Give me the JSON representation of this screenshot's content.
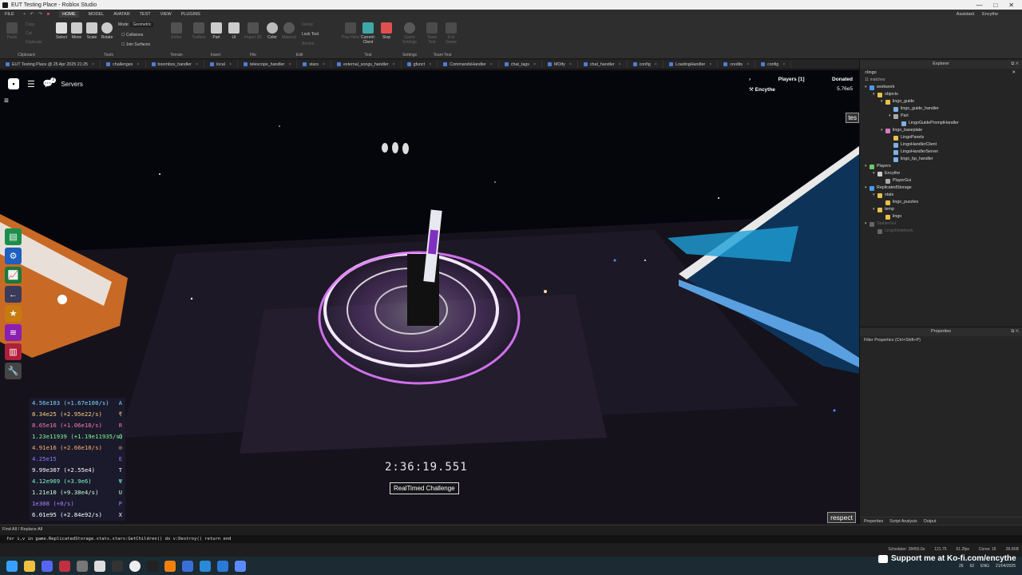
{
  "window": {
    "title": "EUT Testing Place - Roblox Studio",
    "controls": [
      "—",
      "□",
      "✕"
    ]
  },
  "menubar": {
    "file": "FILE",
    "tabs": [
      "HOME",
      "MODEL",
      "AVATAR",
      "TEST",
      "VIEW",
      "PLUGINS"
    ],
    "assistant": "Assistant",
    "user": "Encythe"
  },
  "ribbon": {
    "clipboard": {
      "label": "Clipboard",
      "paste": "Paste",
      "copy": "Copy",
      "cut": "Cut",
      "duplicate": "Duplicate"
    },
    "tools": {
      "label": "Tools",
      "select": "Select",
      "move": "Move",
      "scale": "Scale",
      "rotate": "Rotate",
      "mode_label": "Mode:",
      "mode_value": "Geometric",
      "collisions": "Collisions",
      "join_surfaces": "Join Surfaces"
    },
    "terrain": {
      "label": "Terrain",
      "editor": "Editor"
    },
    "insert": {
      "label": "Insert",
      "toolbox": "Toolbox",
      "part": "Part",
      "ui": "UI"
    },
    "file": {
      "label": "File",
      "import3d": "Import 3D"
    },
    "edit": {
      "label": "Edit",
      "color": "Color",
      "material": "Material",
      "group": "Group",
      "lock": "Lock Tool",
      "anchor": "Anchor"
    },
    "test": {
      "label": "Test",
      "play": "Play Here",
      "current": "Current: Client",
      "stop": "Stop"
    },
    "settings": {
      "label": "Settings",
      "game_settings": "Game Settings"
    },
    "team_test": {
      "label": "Team Test",
      "team_test": "Team Test",
      "exit_game": "Exit Game"
    }
  },
  "tabs": [
    "EUT Testing Place @ 25 Apr 2025 21:25",
    "challenges",
    "boombox_handler",
    "local",
    "telescope_handler",
    "stars",
    "external_songs_handler",
    "gfunct",
    "CommandsHandler",
    "chat_tags",
    "MOify",
    "chat_handler",
    "config",
    "LoadingHandler",
    "credits",
    "config"
  ],
  "viewport": {
    "servers": "Servers",
    "chat_badge": "2",
    "players_header": "Players [1]",
    "donated_header": "Donated",
    "player_name": "Encythe",
    "player_donated": "5.76e5",
    "tes_button": "tes",
    "respect_button": "respect",
    "timer": "2:36:19.551",
    "challenge_label": "RealTimed Challenge",
    "stats": [
      {
        "text": "4.56e103 (+1.67e100/s)",
        "color": "#7fd7ff",
        "sym": "A"
      },
      {
        "text": "8.34e25 (+2.95e22/s)",
        "color": "#ffcf7a",
        "sym": "₹"
      },
      {
        "text": "8.65e16 (+1.06e10/s)",
        "color": "#ff7aa8",
        "sym": "R"
      },
      {
        "text": "1.23e11939 (+1.19e11935/s)",
        "color": "#7dff8a",
        "sym": "Ω"
      },
      {
        "text": "4.91e16 (+2.66e10/s)",
        "color": "#ffb36b",
        "sym": "⊙"
      },
      {
        "text": "4.25e15",
        "color": "#8a7dff",
        "sym": "E"
      },
      {
        "text": "9.99e307 (+2.55e4)",
        "color": "#ffffff",
        "sym": "T"
      },
      {
        "text": "4.12e969 (+3.9e6)",
        "color": "#7affc8",
        "sym": "Ψ"
      },
      {
        "text": "1.21e10 (+9.38e4/s)",
        "color": "#c8ffd0",
        "sym": "U"
      },
      {
        "text": "1e308 (+0/s)",
        "color": "#b080ff",
        "sym": "P"
      },
      {
        "text": "6.01e95 (+2.84e92/s)",
        "color": "#ffffff",
        "sym": "X"
      }
    ]
  },
  "command_bar": {
    "label": "Find All / Replace All",
    "command": "for i,v in game.ReplicatedStorage.stats.stars:GetChildren() do v:Destroy() return end",
    "status": [
      "Scheduler: 28455.0s",
      "121.75",
      "61.2fps",
      "Cores: 16",
      "28.0KB"
    ]
  },
  "explorer": {
    "title": "Explorer",
    "search": "lingo",
    "matches": "11 matches",
    "tree": [
      {
        "depth": 0,
        "label": "workwork",
        "icon": "#4a9be8",
        "arrow": "▾"
      },
      {
        "depth": 1,
        "label": "objects",
        "icon": "#e8c14a",
        "arrow": "▾"
      },
      {
        "depth": 2,
        "label": "lingo_guide",
        "icon": "#e8c14a",
        "arrow": "▾"
      },
      {
        "depth": 3,
        "label": "lingo_guide_handler",
        "icon": "#7fb1e8",
        "arrow": ""
      },
      {
        "depth": 3,
        "label": "Part",
        "icon": "#aaaaaa",
        "arrow": "▾"
      },
      {
        "depth": 4,
        "label": "LingoGuidePromptHandler",
        "icon": "#7fb1e8",
        "arrow": ""
      },
      {
        "depth": 2,
        "label": "lingo_baseplate",
        "icon": "#d47ac8",
        "arrow": "▾"
      },
      {
        "depth": 3,
        "label": "LingoPanels",
        "icon": "#e8c14a",
        "arrow": ""
      },
      {
        "depth": 3,
        "label": "LingoHandlerClient",
        "icon": "#7fb1e8",
        "arrow": ""
      },
      {
        "depth": 3,
        "label": "LingoHandlerServer",
        "icon": "#7fb1e8",
        "arrow": ""
      },
      {
        "depth": 3,
        "label": "lingo_bp_handler",
        "icon": "#7fb1e8",
        "arrow": ""
      },
      {
        "depth": 0,
        "label": "Players",
        "icon": "#6cc86c",
        "arrow": "▾"
      },
      {
        "depth": 1,
        "label": "Encythe",
        "icon": "#cccccc",
        "arrow": "▾"
      },
      {
        "depth": 2,
        "label": "PlayerGui",
        "icon": "#aaaaaa",
        "arrow": ""
      },
      {
        "depth": 0,
        "label": "ReplicatedStorage",
        "icon": "#4a9be8",
        "arrow": "▾"
      },
      {
        "depth": 1,
        "label": "stats",
        "icon": "#e8c14a",
        "arrow": "▾"
      },
      {
        "depth": 2,
        "label": "lingo_puzzles",
        "icon": "#e8c14a",
        "arrow": ""
      },
      {
        "depth": 1,
        "label": "temp",
        "icon": "#e8c14a",
        "arrow": "▾"
      },
      {
        "depth": 2,
        "label": "lingo",
        "icon": "#e8c14a",
        "arrow": ""
      },
      {
        "depth": 0,
        "label": "StarterGui",
        "icon": "#666666",
        "arrow": "▾",
        "faded": true
      },
      {
        "depth": 1,
        "label": "LingoNotebook",
        "icon": "#666666",
        "arrow": "",
        "faded": true
      }
    ]
  },
  "properties": {
    "title": "Properties",
    "filter": "Filter Properties (Ctrl+Shift+P)",
    "tabs": [
      "Properties",
      "Script Analysis",
      "Output"
    ]
  },
  "taskbar": {
    "kofi": "Support me at Ko-fi.com/encythe",
    "tray": [
      "26",
      "62",
      "ENG",
      "21/04/2025"
    ]
  }
}
